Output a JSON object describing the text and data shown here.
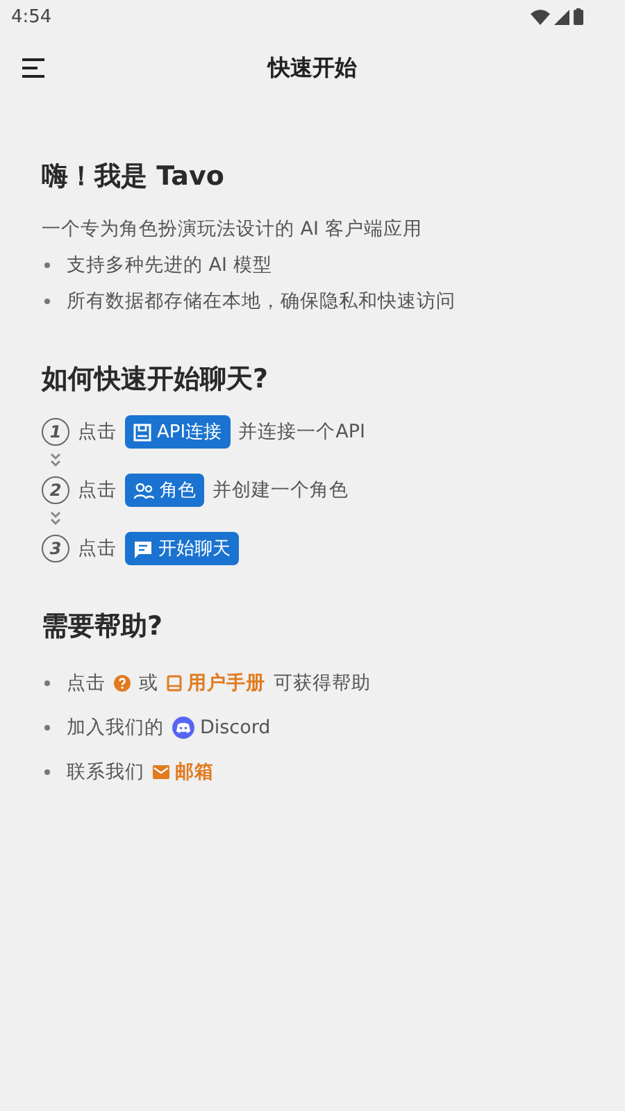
{
  "status_bar": {
    "time": "4:54"
  },
  "app_bar": {
    "title": "快速开始"
  },
  "intro": {
    "heading": "嗨！我是 Tavo",
    "description": "一个专为角色扮演玩法设计的 AI 客户端应用",
    "bullets": [
      "支持多种先进的 AI 模型",
      "所有数据都存储在本地，确保隐私和快速访问"
    ]
  },
  "steps": {
    "heading": "如何快速开始聊天?",
    "items": [
      {
        "number": "1",
        "before": "点击",
        "button": {
          "kind": "api",
          "label": "API连接"
        },
        "after": "并连接一个API"
      },
      {
        "number": "2",
        "before": "点击",
        "button": {
          "kind": "people",
          "label": "角色"
        },
        "after": "并创建一个角色"
      },
      {
        "number": "3",
        "before": "点击",
        "button": {
          "kind": "chat",
          "label": "开始聊天"
        }
      }
    ]
  },
  "help": {
    "heading": "需要帮助?",
    "items": [
      {
        "parts": [
          {
            "kind": "text",
            "text": "点击"
          },
          {
            "kind": "help"
          },
          {
            "kind": "text",
            "text": "或"
          },
          {
            "kind": "manual",
            "text": "用户手册"
          },
          {
            "kind": "text",
            "text": "可获得帮助"
          }
        ]
      },
      {
        "parts": [
          {
            "kind": "text",
            "text": "加入我们的"
          },
          {
            "kind": "discord",
            "text": "Discord"
          }
        ]
      },
      {
        "parts": [
          {
            "kind": "text",
            "text": "联系我们"
          },
          {
            "kind": "mail",
            "text": "邮箱"
          }
        ]
      }
    ]
  }
}
